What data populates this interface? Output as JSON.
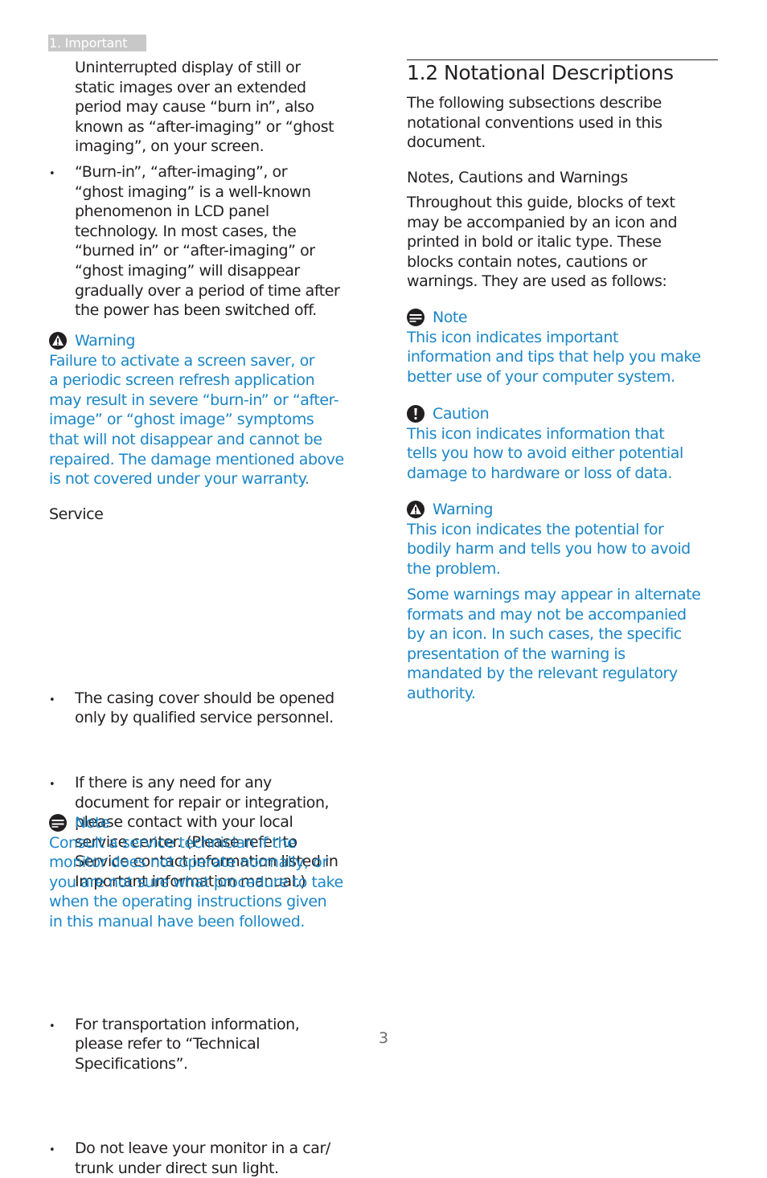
{
  "header": {
    "section_tab": "1. Important"
  },
  "left_column": {
    "intro_paragraph": [
      "Uninterrupted display of still or",
      "static images over an extended",
      "period may cause “burn in”, also",
      "known as “after-imaging” or “ghost",
      "imaging”, on your screen."
    ],
    "bullet_burn_in": [
      "“Burn-in”, “after-imaging”, or",
      "“ghost imaging” is a well-known",
      "phenomenon in LCD panel",
      "technology. In most cases, the",
      "“burned in” or “after-imaging” or",
      "“ghost imaging” will disappear",
      "gradually over a period of time after",
      "the power has been switched off."
    ],
    "warning": {
      "icon": "warning-triangle-icon",
      "title": "Warning",
      "lines": [
        "Failure to activate a screen saver, or",
        "a periodic screen refresh application",
        "may result in severe “burn-in” or “after-",
        "image” or “ghost image” symptoms",
        "that will not disappear and cannot be",
        "repaired. The damage mentioned above",
        "is not covered under your warranty."
      ]
    },
    "service": {
      "heading": "Service",
      "bullets": [
        [
          "The casing cover should be opened",
          "only by qualified service personnel."
        ],
        [
          "If there is any need for any",
          "document for repair or integration,",
          "please contact with your local",
          "service center. (Please refer to",
          "Service contact information listed in",
          "Important information manual.)"
        ],
        [
          "For transportation information,",
          "please refer to “Technical",
          "Specifications”."
        ],
        [
          "Do not leave your monitor in a car/",
          "trunk under direct sun light."
        ]
      ]
    },
    "note": {
      "icon": "note-icon",
      "title": "Note",
      "lines": [
        "Consult a service technician if the",
        "monitor does not operate normally, or",
        "you are not sure what procedure to take",
        "when the operating instructions given",
        "in this manual have been followed."
      ]
    }
  },
  "right_column": {
    "section_number": "1.2",
    "section_title": "Notational Descriptions",
    "intro_lines": [
      "The following subsections describe",
      "notational conventions used in this",
      "document."
    ],
    "subheading": "Notes, Cautions and Warnings",
    "body_lines": [
      "Throughout this guide, blocks of text",
      "may be accompanied by an icon and",
      "printed in bold or italic type. These",
      "blocks contain notes, cautions or",
      "warnings. They are used as follows:"
    ],
    "note": {
      "icon": "note-icon",
      "title": "Note",
      "lines": [
        "This icon indicates important",
        "information and tips that help you make",
        "better use of your computer system."
      ]
    },
    "caution": {
      "icon": "caution-exclamation-icon",
      "title": "Caution",
      "lines": [
        "This icon indicates information that",
        "tells you how to avoid either potential",
        "damage to hardware or loss of data."
      ]
    },
    "warning": {
      "icon": "warning-triangle-icon",
      "title": "Warning",
      "lines": [
        "This icon indicates the potential for",
        "bodily harm and tells you how to avoid",
        "the problem."
      ],
      "extra_lines": [
        "Some warnings may appear in alternate",
        "formats and may not be accompanied",
        "by an icon. In such cases, the specific",
        "presentation of the warning is",
        "mandated by the relevant regulatory",
        "authority."
      ]
    }
  },
  "footer": {
    "page_number": "3"
  },
  "colors": {
    "accent_blue": "#1a86c7",
    "body_text": "#231f20",
    "header_tab_bg": "#c8c8c8"
  }
}
